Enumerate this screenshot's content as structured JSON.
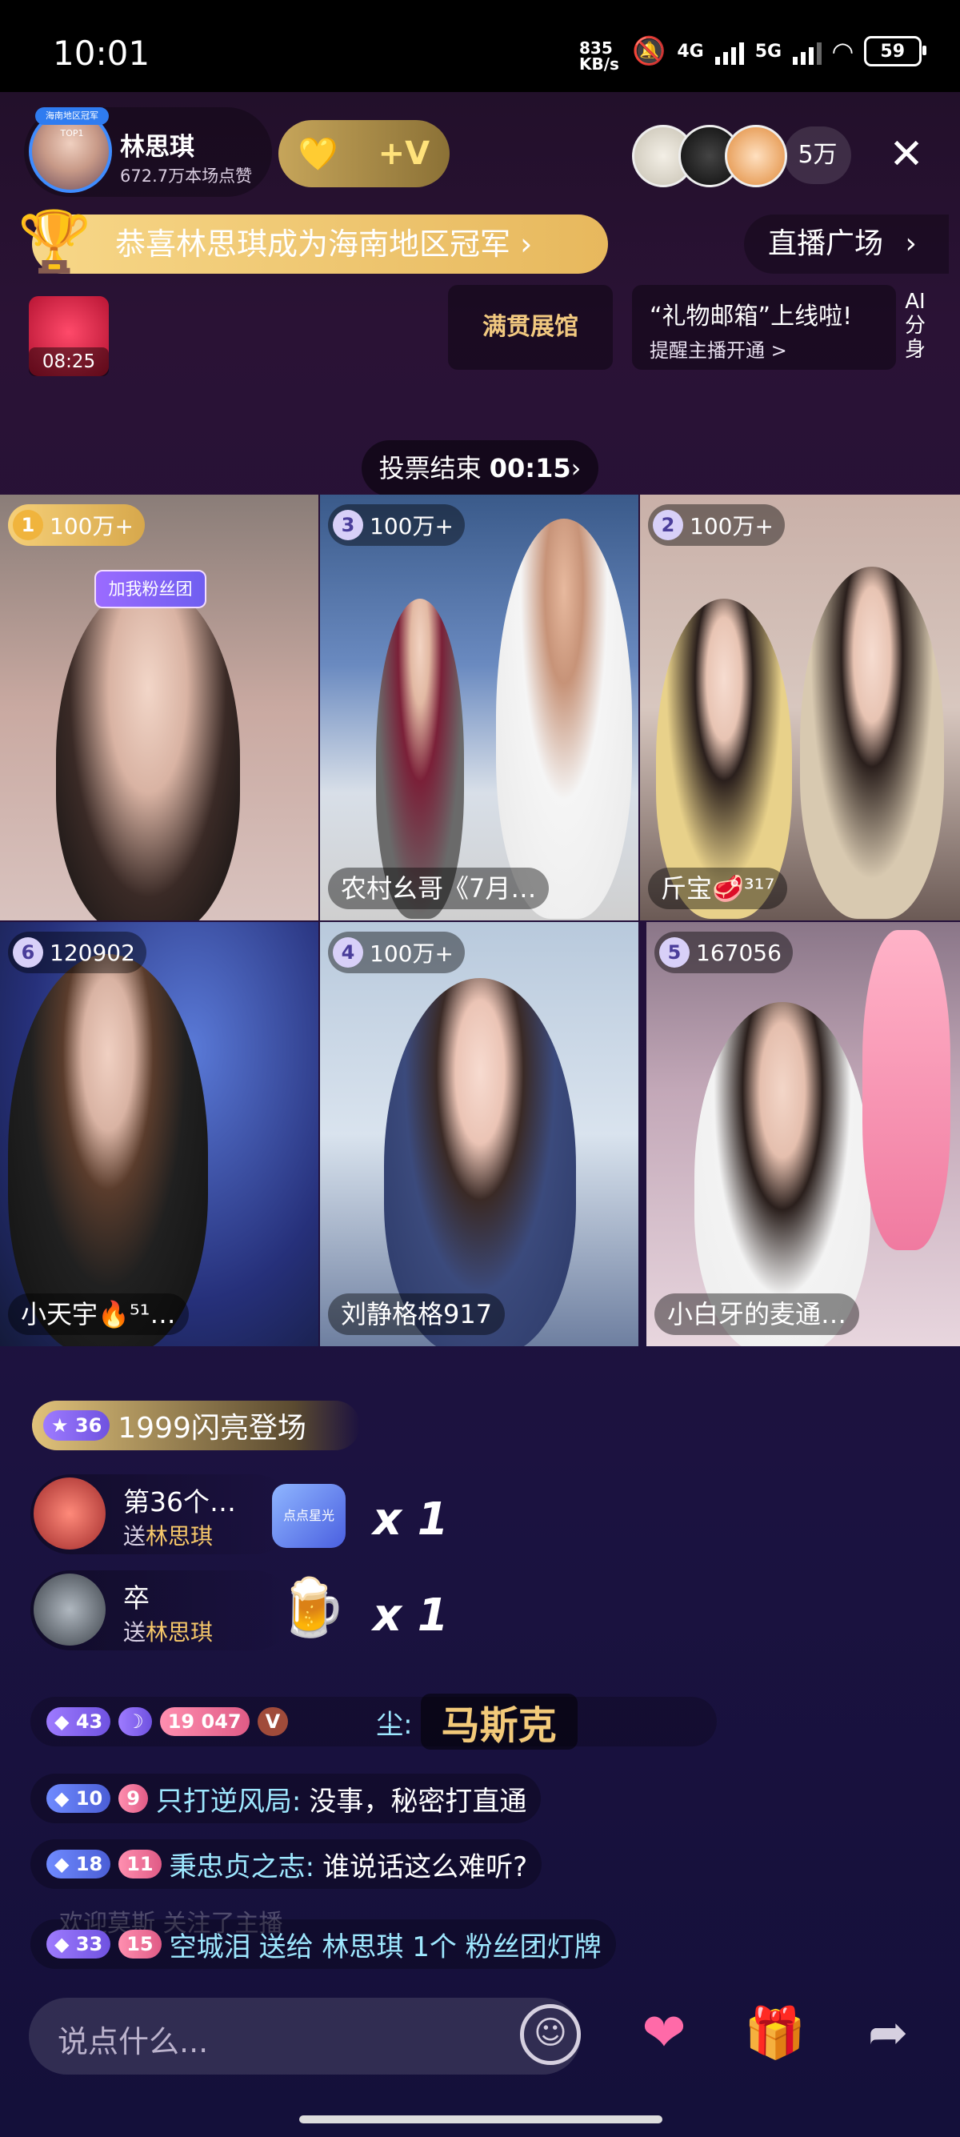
{
  "status_bar": {
    "time": "10:01",
    "net_speed_value": "835",
    "net_speed_unit": "KB/s",
    "mute_icon": "bell-off-icon",
    "signal1_label": "4G",
    "signal2_label": "5G",
    "wifi_icon": "wifi-icon",
    "battery": "59"
  },
  "host": {
    "name": "林思琪",
    "likes": "672.7万本场点赞",
    "avatar_tag": "海南地区冠军TOP1",
    "fan_heart_icon": "heart-plus-icon",
    "fan_v_label": "+V"
  },
  "viewers": {
    "count": "5万",
    "close_icon": "close-icon"
  },
  "banner": {
    "notice": "恭喜林思琪成为海南地区冠军 ›",
    "plaza": "直播广场",
    "plaza_chevron": "›",
    "gift_timer": "08:25",
    "hall": "满贯展馆",
    "mailbox_title": "“礼物邮箱”上线啦!",
    "mailbox_sub": "提醒主播开通 >",
    "ai_split": "AI分身"
  },
  "vote": {
    "label": "投票结束 ",
    "time": "00:15",
    "chevron": "›"
  },
  "grid": {
    "join_badge": "加我粉丝团",
    "tiles": [
      {
        "rank": "1",
        "score": "100万+",
        "name": ""
      },
      {
        "rank": "3",
        "score": "100万+",
        "name": "农村幺哥《7月…"
      },
      {
        "rank": "2",
        "score": "100万+",
        "name": "斤宝🥩³¹⁷"
      },
      {
        "rank": "6",
        "score": "120902",
        "name": "小天宇🔥⁵¹…"
      },
      {
        "rank": "4",
        "score": "100万+",
        "name": "刘静格格917"
      },
      {
        "rank": "5",
        "score": "167056",
        "name": "小白牙的麦通…"
      }
    ]
  },
  "chat": {
    "entrance_level": "36",
    "entrance_text": "1999闪亮登场",
    "gifts": [
      {
        "name": "第36个…",
        "to_prefix": "送",
        "to": "林思琪",
        "count": "x 1",
        "gift_label": "点点星光"
      },
      {
        "name": "卒",
        "to_prefix": "送",
        "to": "林思琪",
        "count": "x 1",
        "gift_label": "啤酒"
      }
    ],
    "row1": {
      "badge_level": "43",
      "badge_moon": "☽",
      "badge_fan": "19",
      "badge_fan_text": "047",
      "badge_v": "V",
      "name": "尘:",
      "plate": "马斯克"
    },
    "messages": [
      {
        "level": "10",
        "fan": "9",
        "user": "只打逆风局:",
        "text": "没事，秘密打直通"
      },
      {
        "level": "18",
        "fan": "11",
        "user": "秉忠贞之志:",
        "text": "谁说话这么难听?"
      },
      {
        "level": "33",
        "fan": "15",
        "user": "空城泪",
        "text": "送给 林思琪 1个 粉丝团灯牌"
      }
    ],
    "faded": "欢迎莫斯 关注了主播"
  },
  "bottom": {
    "placeholder": "说点什么...",
    "emoji_icon": "smile-icon",
    "heart_icon": "heart-icon",
    "gift_icon": "gift-icon",
    "share_icon": "share-icon"
  }
}
